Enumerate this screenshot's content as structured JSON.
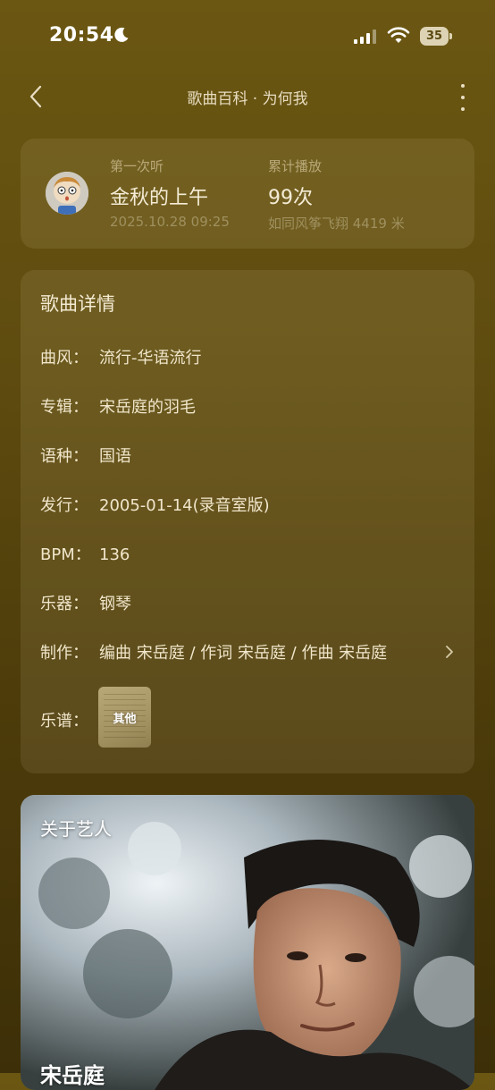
{
  "status_bar": {
    "time": "20:54",
    "battery": "35"
  },
  "nav": {
    "title": "歌曲百科 · 为何我"
  },
  "listen": {
    "first_label": "第一次听",
    "first_value": "金秋的上午",
    "first_date": "2025.10.28 09:25",
    "plays_label": "累计播放",
    "plays_value": "99次",
    "plays_sub": "如同风筝飞翔 4419 米"
  },
  "details": {
    "title": "歌曲详情",
    "genre_key": "曲风：",
    "genre_val": "流行-华语流行",
    "album_key": "专辑：",
    "album_val": "宋岳庭的羽毛",
    "lang_key": "语种：",
    "lang_val": "国语",
    "release_key": "发行：",
    "release_val": "2005-01-14(录音室版)",
    "bpm_key": "BPM：",
    "bpm_val": "136",
    "inst_key": "乐器：",
    "inst_val": "钢琴",
    "credits_key": "制作：",
    "credits_val": "编曲 宋岳庭 / 作词 宋岳庭 / 作曲 宋岳庭",
    "sheet_key": "乐谱：",
    "sheet_thumb": "其他"
  },
  "artist": {
    "title": "关于艺人",
    "name": "宋岳庭"
  },
  "icons": {
    "moon": "moon-icon",
    "back": "chevron-left-icon",
    "more": "more-vertical-icon",
    "chevron": "chevron-right-icon",
    "wifi": "wifi-icon"
  }
}
